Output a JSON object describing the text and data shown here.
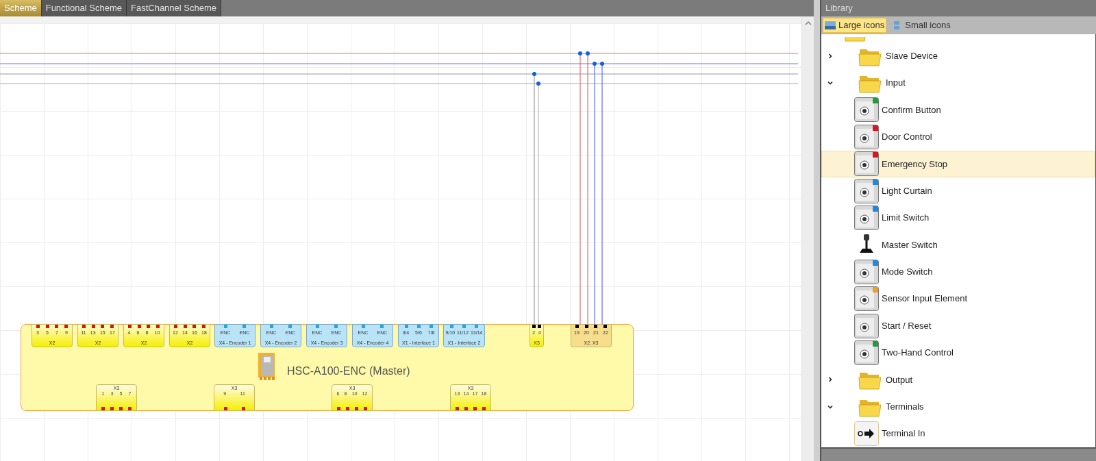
{
  "tabs": [
    {
      "label": "Scheme",
      "selected": true
    },
    {
      "label": "Functional Scheme",
      "selected": false
    },
    {
      "label": "FastChannel Scheme",
      "selected": false
    }
  ],
  "device": {
    "name": "HSC-A100-ENC (Master)",
    "top_modules": [
      {
        "kind": "x2",
        "label": "X2",
        "numbers": [
          "3",
          "5",
          "7",
          "9"
        ]
      },
      {
        "kind": "x2",
        "label": "X2",
        "numbers": [
          "11",
          "13",
          "15",
          "17"
        ]
      },
      {
        "kind": "x2",
        "label": "X2",
        "numbers": [
          "4",
          "6",
          "8",
          "10"
        ]
      },
      {
        "kind": "x2",
        "label": "X2",
        "numbers": [
          "12",
          "14",
          "16",
          "18"
        ]
      },
      {
        "kind": "enc",
        "label": "X4 - Encoder 1",
        "numbers": [
          "ENC",
          "ENC"
        ]
      },
      {
        "kind": "enc",
        "label": "X4 - Encoder 2",
        "numbers": [
          "ENC",
          "ENC"
        ]
      },
      {
        "kind": "enc",
        "label": "X4 - Encoder 3",
        "numbers": [
          "ENC",
          "ENC"
        ]
      },
      {
        "kind": "enc",
        "label": "X4 - Encoder 4",
        "numbers": [
          "ENC",
          "ENC"
        ]
      },
      {
        "kind": "enc",
        "label": "X1 - Interface 1",
        "numbers": [
          "3/4",
          "5/6",
          "7/8"
        ]
      },
      {
        "kind": "enc",
        "label": "X1 - Interface 2",
        "numbers": [
          "9/10",
          "11/12",
          "13/14"
        ]
      },
      {
        "kind": "x3",
        "label": "X3",
        "numbers": [
          "2",
          "4"
        ]
      },
      {
        "kind": "x2x3",
        "label": "X2, X3",
        "numbers": [
          "19",
          "20",
          "21",
          "22"
        ]
      }
    ],
    "bottom_modules": [
      {
        "label": "X3",
        "numbers": [
          "1",
          "3",
          "5",
          "7"
        ]
      },
      {
        "label": "X3",
        "numbers": [
          "9",
          "11"
        ]
      },
      {
        "label": "X3",
        "numbers": [
          "6",
          "8",
          "10",
          "12"
        ]
      },
      {
        "label": "X3",
        "numbers": [
          "13",
          "14",
          "17",
          "18"
        ]
      }
    ]
  },
  "library": {
    "title": "Library",
    "views": [
      {
        "label": "Large icons",
        "selected": true
      },
      {
        "label": "Small icons",
        "selected": false
      }
    ],
    "tree": [
      {
        "kind": "folder",
        "label": "Slave Device",
        "expanded": false
      },
      {
        "kind": "folder",
        "label": "Input",
        "expanded": true,
        "children": [
          {
            "kind": "device",
            "label": "Confirm Button",
            "color": "#1e9e3a",
            "selected": false
          },
          {
            "kind": "device",
            "label": "Door Control",
            "color": "#e0141e",
            "selected": false
          },
          {
            "kind": "device",
            "label": "Emergency Stop",
            "color": "#e0141e",
            "selected": true
          },
          {
            "kind": "device",
            "label": "Light Curtain",
            "color": "#1e88e5",
            "selected": false
          },
          {
            "kind": "device",
            "label": "Limit Switch",
            "color": "#1e88e5",
            "selected": false
          },
          {
            "kind": "plain",
            "label": "Master Switch",
            "selected": false
          },
          {
            "kind": "device",
            "label": "Mode Switch",
            "color": "#1e88e5",
            "selected": false
          },
          {
            "kind": "device",
            "label": "Sensor Input Element",
            "color": "#f0a020",
            "selected": false
          },
          {
            "kind": "device",
            "label": "Start / Reset",
            "selected": false
          },
          {
            "kind": "device",
            "label": "Two-Hand Control",
            "color": "#1e9e3a",
            "selected": false
          }
        ]
      },
      {
        "kind": "folder",
        "label": "Output",
        "expanded": false
      },
      {
        "kind": "folder",
        "label": "Terminals",
        "expanded": true,
        "children": [
          {
            "kind": "terminal",
            "label": "Terminal In",
            "selected": false
          }
        ]
      }
    ]
  }
}
